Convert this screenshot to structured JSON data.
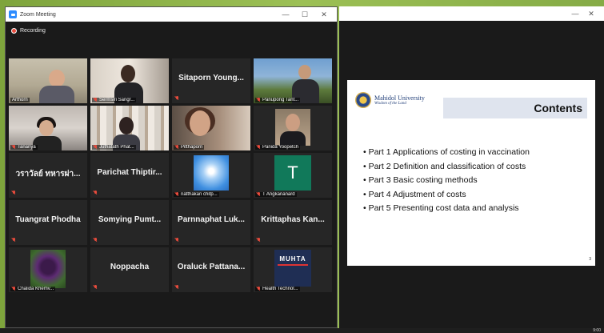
{
  "zoom": {
    "title": "Zoom Meeting",
    "recording": "Recording",
    "controls": {
      "minimize": "—",
      "maximize": "☐",
      "close": "✕"
    }
  },
  "participants": [
    {
      "label": "Arthorn",
      "muted": false,
      "active": true,
      "video": "v1"
    },
    {
      "label": "Sermsiri Sangr...",
      "muted": true,
      "video": "v2"
    },
    {
      "name_text": "Sitaporn Young...",
      "muted": true
    },
    {
      "label": "Panupong Tant...",
      "muted": true,
      "video": "v4"
    },
    {
      "label": "Tananya",
      "muted": true,
      "video": "v5"
    },
    {
      "label": "Juthatath Phat...",
      "muted": true,
      "video": "v6"
    },
    {
      "label": "Pitthaporn",
      "muted": true,
      "video": "v7"
    },
    {
      "label": "Panida Yoopetch",
      "muted": true,
      "video": "v8"
    },
    {
      "name_text": "วราวัลย์ ทหารผ่า...",
      "muted": true
    },
    {
      "name_text": "Parichat Thiptir...",
      "muted": true
    },
    {
      "label": "natthakan chitp...",
      "muted": true,
      "video": "sky"
    },
    {
      "label": "T Angkananard",
      "muted": true,
      "video": "t",
      "avatar_letter": "T"
    },
    {
      "name_text": "Tuangrat Phodha",
      "muted": true
    },
    {
      "name_text": "Somying Pumt...",
      "muted": true
    },
    {
      "name_text": "Parnnaphat Luk...",
      "muted": true
    },
    {
      "name_text": "Krittaphas Kan...",
      "muted": true
    },
    {
      "label": "Chalida Khemv...",
      "muted": true,
      "video": "flower"
    },
    {
      "name_text": "Noppacha",
      "muted": true
    },
    {
      "name_text": "Oraluck Pattana...",
      "muted": true
    },
    {
      "label": "Health Technol...",
      "muted": true,
      "video": "muhta",
      "logo_text": "MUHTA"
    }
  ],
  "share": {
    "controls": {
      "minimize": "—",
      "close": "✕"
    },
    "slide": {
      "university": "Mahidol University",
      "motto": "Wisdom of the Land",
      "title": "Contents",
      "bullets": [
        "Part 1 Applications of costing in vaccination",
        "Part 2 Definition and classification of costs",
        "Part 3 Basic costing methods",
        "Part 4 Adjustment of costs",
        "Part 5 Presenting cost data and analysis"
      ],
      "page": "3"
    }
  },
  "taskbar": {
    "clock": "9:00"
  }
}
